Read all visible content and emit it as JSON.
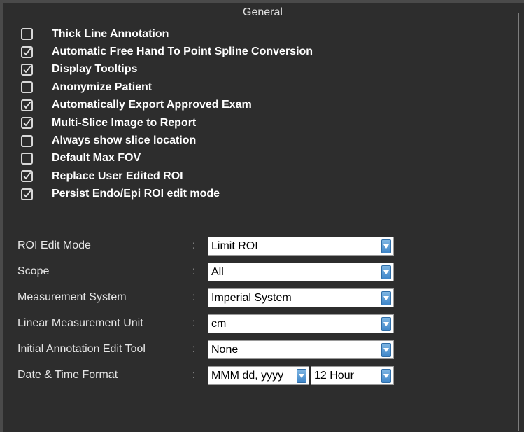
{
  "group": {
    "title": "General"
  },
  "checkboxes": [
    {
      "label": "Thick Line Annotation",
      "checked": false
    },
    {
      "label": "Automatic Free Hand To Point Spline Conversion",
      "checked": true
    },
    {
      "label": "Display Tooltips",
      "checked": true
    },
    {
      "label": "Anonymize Patient",
      "checked": false
    },
    {
      "label": "Automatically Export Approved Exam",
      "checked": true
    },
    {
      "label": "Multi-Slice Image to Report",
      "checked": true
    },
    {
      "label": "Always show slice location",
      "checked": false
    },
    {
      "label": "Default Max FOV",
      "checked": false
    },
    {
      "label": "Replace User Edited ROI",
      "checked": true
    },
    {
      "label": "Persist Endo/Epi ROI edit mode",
      "checked": true
    }
  ],
  "settings": [
    {
      "label": "ROI Edit Mode",
      "colon": ":",
      "value": "Limit ROI"
    },
    {
      "label": "Scope",
      "colon": ":",
      "value": "All"
    },
    {
      "label": "Measurement System",
      "colon": ":",
      "value": "Imperial System"
    },
    {
      "label": "Linear Measurement Unit",
      "colon": ":",
      "value": "cm"
    },
    {
      "label": "Initial Annotation Edit Tool",
      "colon": ":",
      "value": "None"
    },
    {
      "label": "Date & Time Format",
      "colon": ":",
      "date_value": "MMM dd, yyyy",
      "time_value": "12 Hour"
    }
  ],
  "icons": {
    "checkmark": "checkmark-icon",
    "dropdown_arrow": "chevron-down-icon"
  },
  "colors": {
    "background": "#2d2d2d",
    "text": "#ffffff",
    "dropdown_arrow": "#3f86c9"
  }
}
